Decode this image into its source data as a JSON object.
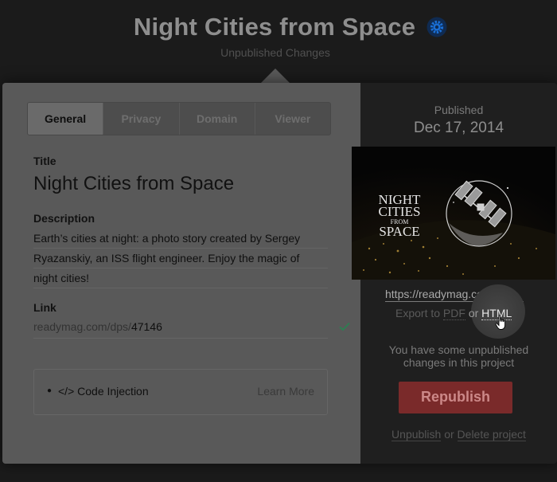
{
  "header": {
    "title": "Night Cities from Space",
    "subtitle": "Unpublished Changes",
    "settings_icon": "gear-icon"
  },
  "tabs": [
    {
      "label": "General",
      "active": true
    },
    {
      "label": "Privacy",
      "active": false
    },
    {
      "label": "Domain",
      "active": false
    },
    {
      "label": "Viewer",
      "active": false
    }
  ],
  "general": {
    "title_label": "Title",
    "title_value": "Night Cities from Space",
    "description_label": "Description",
    "description_lines": [
      "Earth’s cities at night: a photo story created by Sergey",
      "Ryazanskiy, an ISS flight engineer. Enjoy the magic of",
      "night cities!"
    ],
    "link_label": "Link",
    "link_prefix": "readymag.com/dps/",
    "link_value": "47146",
    "link_valid_icon": "check-icon",
    "code_injection_label": "</> Code Injection",
    "learn_more": "Learn More"
  },
  "publish": {
    "published_label": "Published",
    "published_date": "Dec 17, 2014",
    "thumbnail_lines": [
      "NIGHT",
      "CITIES",
      "FROM",
      "SPACE"
    ],
    "url": "https://readymag.com/…",
    "export_prefix": "Export to",
    "export_pdf": "PDF",
    "export_or": "or",
    "export_html": "HTML",
    "unpublished_message": "You have some unpublished changes in this project",
    "republish_label": "Republish",
    "unpublish_label": "Unpublish",
    "bottom_or": "or",
    "delete_label": "Delete project"
  },
  "colors": {
    "accent_blue": "#1a6fd6",
    "republish_red": "#7a2a2a",
    "check_green": "#2f7d52"
  }
}
